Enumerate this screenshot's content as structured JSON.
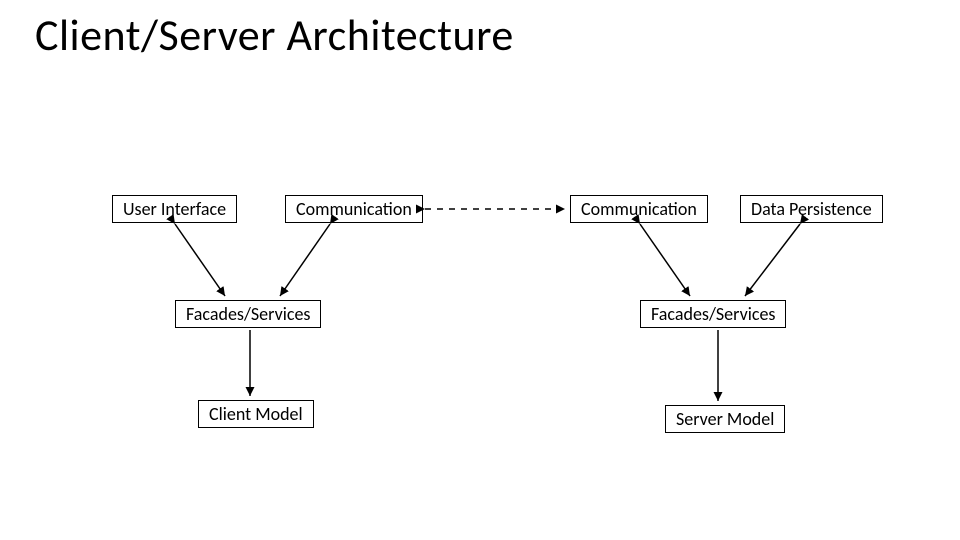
{
  "title": "Client/Server Architecture",
  "boxes": {
    "user_interface": "User Interface",
    "communication_left": "Communication",
    "communication_right": "Communication",
    "data_persistence": "Data Persistence",
    "facades_services_left": "Facades/Services",
    "facades_services_right": "Facades/Services",
    "client_model": "Client Model",
    "server_model": "Server Model"
  }
}
